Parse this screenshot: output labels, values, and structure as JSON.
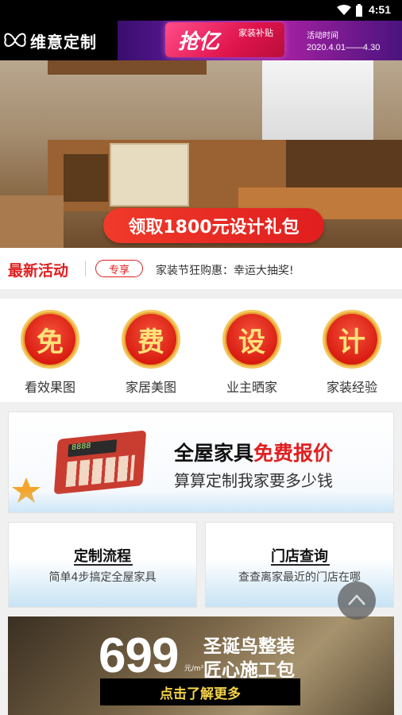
{
  "status_bar": {
    "time": "4:51"
  },
  "header": {
    "app_name": "维意定制",
    "promo": {
      "big_text": "抢亿",
      "small_text": "家装补贴",
      "date_label": "活动时间",
      "date_range": "2020.4.01——4.30"
    }
  },
  "hero": {
    "cta_label": "领取1800元设计礼包"
  },
  "news": {
    "title": "最新活动",
    "badge": "专享",
    "text": "家装节狂购惠：幸运大抽奖!"
  },
  "features": [
    {
      "char": "免",
      "label": "看效果图"
    },
    {
      "char": "费",
      "label": "家居美图"
    },
    {
      "char": "设",
      "label": "业主晒家"
    },
    {
      "char": "计",
      "label": "家装经验"
    }
  ],
  "quote_banner": {
    "line1_plain": "全屋家具",
    "line1_highlight": "免费报价",
    "line2": "算算定制我家要多少钱",
    "calc_display": "8888"
  },
  "cards": [
    {
      "title": "定制流程",
      "subtitle": "简单4步搞定全屋家具"
    },
    {
      "title": "门店查询",
      "subtitle": "查查离家最近的门店在哪"
    }
  ],
  "bottom_banner": {
    "price": "699",
    "unit": "元/m²",
    "line1": "圣诞鸟整装",
    "line2": "匠心施工包",
    "cta": "点击了解更多"
  },
  "colors": {
    "brand_red": "#e02020",
    "gold": "#f3c860"
  }
}
